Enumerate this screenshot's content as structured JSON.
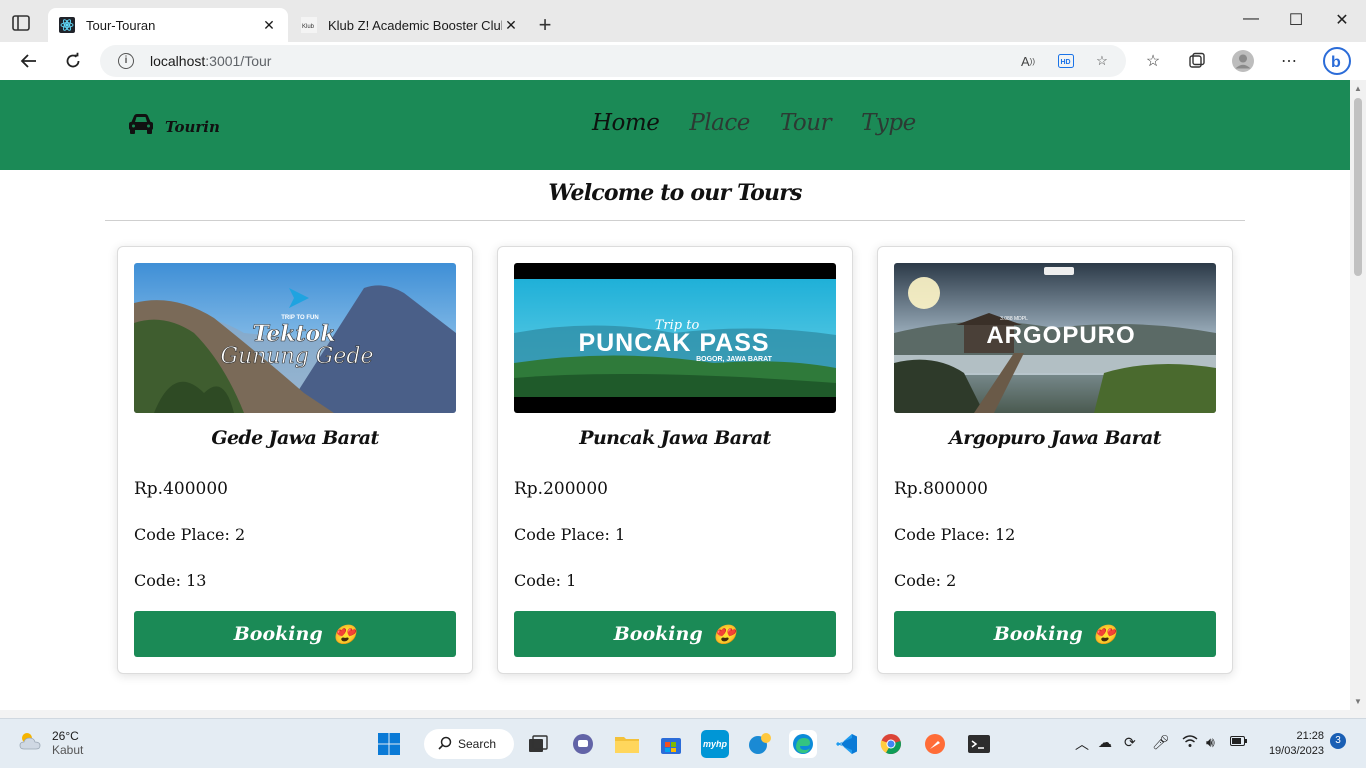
{
  "browser": {
    "tabs": [
      {
        "title": "Tour-Touran",
        "active": true
      },
      {
        "title": "Klub Z! Academic Booster Club",
        "active": false
      }
    ],
    "url_host": "localhost",
    "url_path": ":3001/Tour"
  },
  "site": {
    "brand": "Tourin",
    "nav": [
      "Home",
      "Place",
      "Tour",
      "Type"
    ],
    "heading": "Welcome to our Tours"
  },
  "tours": [
    {
      "place": "Gede Jawa Barat",
      "price": "Rp.400000",
      "code_place": "Code Place: 2",
      "code": "Code: 13",
      "button": "Booking",
      "emoji": "😍",
      "image": {
        "overlay_small": "TRIP TO FUN",
        "overlay_title": "Tektok",
        "overlay_sub": "Gunung Gede"
      }
    },
    {
      "place": "Puncak Jawa Barat",
      "price": "Rp.200000",
      "code_place": "Code Place: 1",
      "code": "Code: 1",
      "button": "Booking",
      "emoji": "😍",
      "image": {
        "overlay_small": "Trip to",
        "overlay_title": "PUNCAK PASS",
        "overlay_sub": "BOGOR, JAWA BARAT"
      }
    },
    {
      "place": "Argopuro Jawa Barat",
      "price": "Rp.800000",
      "code_place": "Code Place: 12",
      "code": "Code: 2",
      "button": "Booking",
      "emoji": "😍",
      "image": {
        "overlay_small": "3.088 MDPL",
        "overlay_title": "ARGOPURO",
        "overlay_sub": ""
      }
    }
  ],
  "taskbar": {
    "weather_temp": "26°C",
    "weather_desc": "Kabut",
    "search_label": "Search",
    "time": "21:28",
    "date": "19/03/2023",
    "notification_count": "3"
  },
  "colors": {
    "brand_green": "#1b8a56",
    "page_bg": "#ffffff"
  }
}
